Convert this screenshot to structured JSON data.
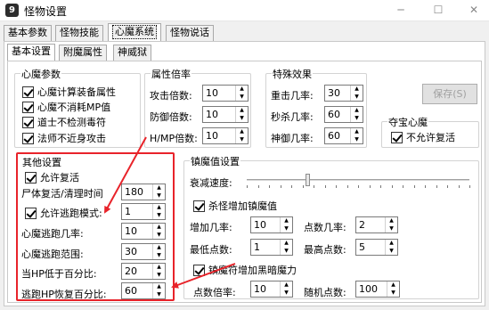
{
  "window": {
    "title": "怪物设置",
    "app_icon": "9",
    "min": "─",
    "max": "☐",
    "close": "✕"
  },
  "top_tabs": [
    "基本参数",
    "怪物技能",
    "心魔系统",
    "怪物说话"
  ],
  "sub_tabs": [
    "基本设置",
    "附魔属性",
    "神威狱"
  ],
  "xinmo": {
    "title": "心魔参数",
    "items": [
      {
        "label": "心魔计算装备属性",
        "checked": true
      },
      {
        "label": "心魔不消耗MP值",
        "checked": true
      },
      {
        "label": "道士不检测毒符",
        "checked": true
      },
      {
        "label": "法师不近身攻击",
        "checked": true
      }
    ]
  },
  "ratio": {
    "title": "属性倍率",
    "rows": [
      {
        "label": "攻击倍数:",
        "value": "10"
      },
      {
        "label": "防御倍数:",
        "value": "10"
      },
      {
        "label": "H/MP倍数:",
        "value": "10"
      }
    ]
  },
  "special": {
    "title": "特殊效果",
    "rows": [
      {
        "label": "重击几率:",
        "value": "30"
      },
      {
        "label": "秒杀几率:",
        "value": "60"
      },
      {
        "label": "神御几率:",
        "value": "60"
      }
    ]
  },
  "save_label": "保存(S)",
  "treasure": {
    "title": "夺宝心魔",
    "item": {
      "label": "不允许复活",
      "checked": true
    }
  },
  "other": {
    "title": "其他设置",
    "allow_revive": {
      "label": "允许复活",
      "checked": true
    },
    "corpse": {
      "label": "尸体复活/清理时间",
      "value": "180"
    },
    "escape_mode": {
      "label": "允许逃跑模式:",
      "value": "1",
      "checked": true
    },
    "rows": [
      {
        "label": "心魔逃跑几率:",
        "value": "10"
      },
      {
        "label": "心魔逃跑范围:",
        "value": "30"
      },
      {
        "label": "当HP低于百分比:",
        "value": "20"
      },
      {
        "label": "逃跑HP恢复百分比:",
        "value": "60"
      }
    ]
  },
  "zhenmo": {
    "title": "镇魔值设置",
    "decay_label": "衰减速度:",
    "decay_level": 0.27,
    "kill_increase": {
      "label": "杀怪增加镇魔值",
      "checked": true
    },
    "add_rate": {
      "label": "增加几率:",
      "value": "10"
    },
    "point_rate": {
      "label": "点数几率:",
      "value": "2"
    },
    "min_points": {
      "label": "最低点数:",
      "value": "1"
    },
    "max_points": {
      "label": "最高点数:",
      "value": "5"
    },
    "dark_power": {
      "label": "镇魔符增加黑暗魔力",
      "checked": true
    },
    "point_mult": {
      "label": "点数倍率:",
      "value": "10"
    },
    "random_points": {
      "label": "随机点数:",
      "value": "100"
    }
  },
  "colors": {
    "highlight": "#e8232a"
  }
}
